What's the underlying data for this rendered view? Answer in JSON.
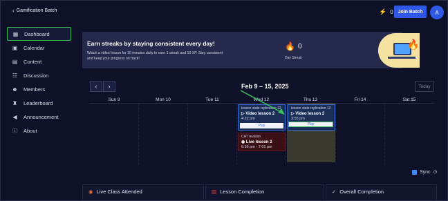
{
  "header": {
    "back_label": "Gamification Batch",
    "xp_value": "0",
    "join_label": "Join Batch",
    "avatar_initial": "A"
  },
  "sidebar": {
    "items": [
      {
        "label": "Dashboard",
        "icon": "dashboard-icon"
      },
      {
        "label": "Calendar",
        "icon": "calendar-icon"
      },
      {
        "label": "Content",
        "icon": "book-icon"
      },
      {
        "label": "Discussion",
        "icon": "discussion-icon"
      },
      {
        "label": "Members",
        "icon": "members-icon"
      },
      {
        "label": "Leaderboard",
        "icon": "trophy-icon"
      },
      {
        "label": "Announcement",
        "icon": "megaphone-icon"
      },
      {
        "label": "About",
        "icon": "info-icon"
      }
    ]
  },
  "banner": {
    "title": "Earn streaks by staying consistent every day!",
    "subtitle": "Watch a video lesson for 10 minutes daily to earn 1 streak and 10 XP. Stay consistent and keep your progress on track!",
    "streak_count": "0",
    "streak_label": "Day Streak"
  },
  "calendar": {
    "range": "Feb 9 – 15, 2025",
    "today_label": "Today",
    "days": [
      "Sun 9",
      "Mon 10",
      "Tue 11",
      "Wed 12",
      "Thu 13",
      "Fri 14",
      "Sat 15"
    ],
    "events": {
      "wed_video": {
        "tag": "lesson stats replication 12",
        "title": "Video lesson 2",
        "time": "4:22 pm",
        "action": "Play"
      },
      "wed_live": {
        "tag": "CAT revision",
        "title": "Live lesson 2",
        "time": "6:56 pm - 7:01 pm"
      },
      "thu_video": {
        "tag": "lesson stats replication 12",
        "title": "Video lesson 2",
        "time": "3:55 pm",
        "action": "Play"
      }
    },
    "sync_label": "Sync"
  },
  "stats": {
    "live": "Live Class Attended",
    "lesson": "Lesson Completion",
    "overall": "Overall Completion"
  },
  "colors": {
    "accent": "#2f57e8",
    "active_border": "#3bbf5a",
    "background": "#0f1128"
  }
}
